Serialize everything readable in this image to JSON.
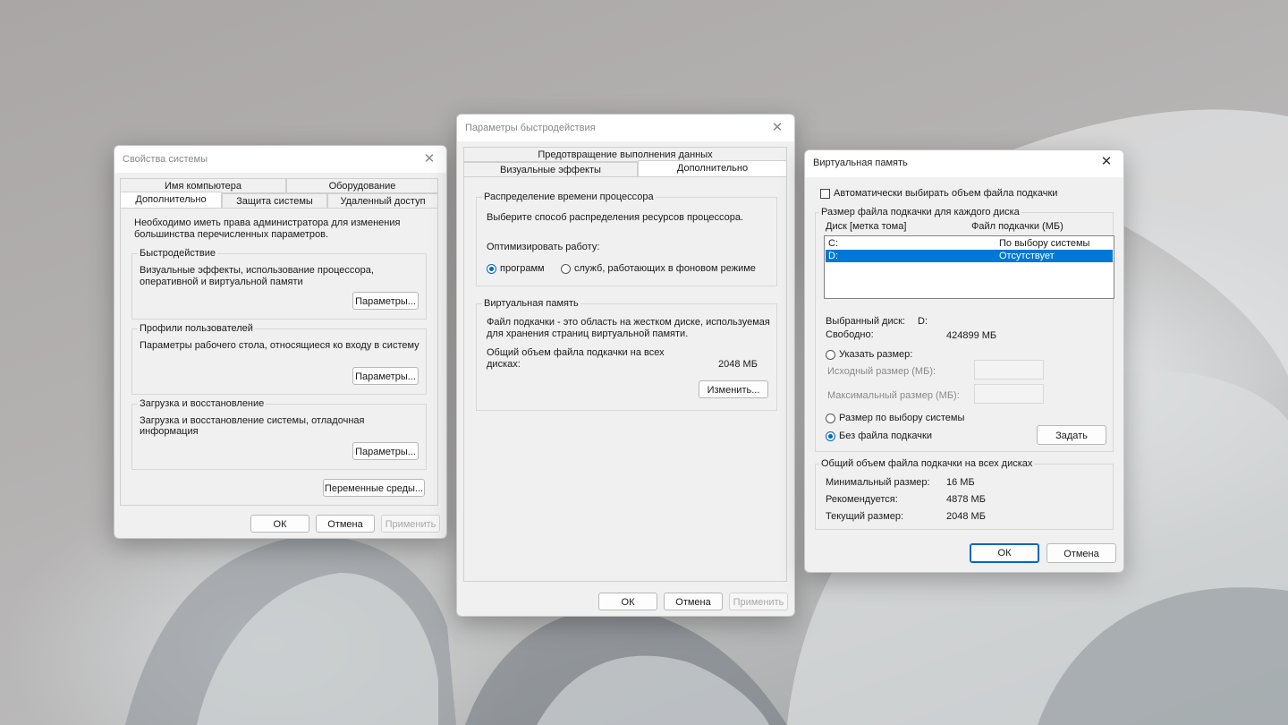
{
  "sysprops": {
    "title": "Свойства системы",
    "close": "✕",
    "tabs": {
      "computer_name": "Имя компьютера",
      "hardware": "Оборудование",
      "advanced": "Дополнительно",
      "protection": "Защита системы",
      "remote": "Удаленный доступ"
    },
    "admin_note": "Необходимо иметь права администратора для изменения большинства перечисленных параметров.",
    "performance": {
      "title": "Быстродействие",
      "desc": "Визуальные эффекты, использование процессора, оперативной и виртуальной памяти",
      "button": "Параметры..."
    },
    "profiles": {
      "title": "Профили пользователей",
      "desc": "Параметры рабочего стола, относящиеся ко входу в систему",
      "button": "Параметры..."
    },
    "startup": {
      "title": "Загрузка и восстановление",
      "desc": "Загрузка и восстановление системы, отладочная информация",
      "button": "Параметры..."
    },
    "env_button": "Переменные среды...",
    "ok": "ОК",
    "cancel": "Отмена",
    "apply": "Применить"
  },
  "perf": {
    "title": "Параметры быстродействия",
    "close": "✕",
    "tabs": {
      "dep": "Предотвращение выполнения данных",
      "visual": "Визуальные эффекты",
      "advanced": "Дополнительно"
    },
    "cpu": {
      "title": "Распределение времени процессора",
      "desc": "Выберите способ распределения ресурсов процессора.",
      "optimize": "Оптимизировать работу:",
      "programs": "программ",
      "services": "служб, работающих в фоновом режиме"
    },
    "vm": {
      "title": "Виртуальная память",
      "desc": "Файл подкачки - это область на жестком диске, используемая для хранения страниц виртуальной памяти.",
      "total_label": "Общий объем файла подкачки на всех дисках:",
      "total_value": "2048 МБ",
      "change": "Изменить..."
    },
    "ok": "ОК",
    "cancel": "Отмена",
    "apply": "Применить"
  },
  "vmem": {
    "title": "Виртуальная память",
    "close": "✕",
    "auto_label": "Автоматически выбирать объем файла подкачки",
    "per_disk_title": "Размер файла подкачки для каждого диска",
    "col_disk": "Диск [метка тома]",
    "col_size": "Файл подкачки (МБ)",
    "disks": [
      {
        "disk": "C:",
        "size": "По выбору системы"
      },
      {
        "disk": "D:",
        "size": "Отсутствует"
      }
    ],
    "selected_label": "Выбранный диск:",
    "selected_value": "D:",
    "free_label": "Свободно:",
    "free_value": "424899 МБ",
    "custom_label": "Указать размер:",
    "initial_label": "Исходный размер (МБ):",
    "max_label": "Максимальный размер (МБ):",
    "system_label": "Размер по выбору системы",
    "nofile_label": "Без файла подкачки",
    "set_button": "Задать",
    "total_title": "Общий объем файла подкачки на всех дисках",
    "min_label": "Минимальный размер:",
    "min_value": "16 МБ",
    "rec_label": "Рекомендуется:",
    "rec_value": "4878 МБ",
    "cur_label": "Текущий размер:",
    "cur_value": "2048 МБ",
    "ok": "ОК",
    "cancel": "Отмена",
    "accent": "#0078d7"
  }
}
